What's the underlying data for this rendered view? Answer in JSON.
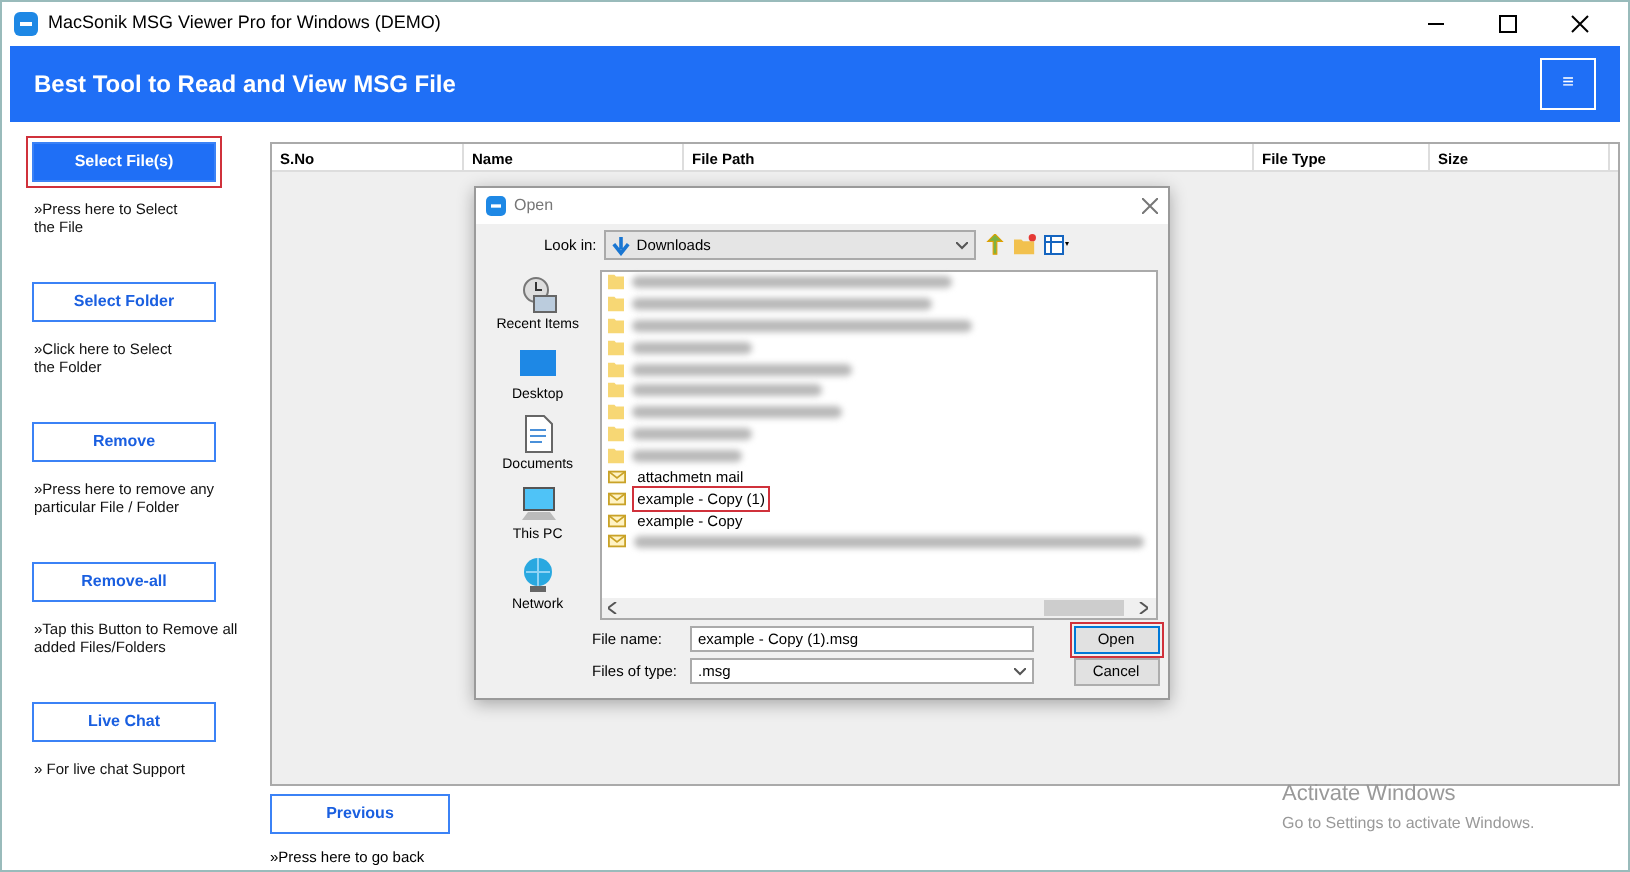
{
  "window": {
    "title": "MacSonik MSG Viewer Pro for Windows (DEMO)"
  },
  "header": {
    "title": "Best Tool to Read and View MSG File",
    "menu_button": "≡"
  },
  "actions": [
    {
      "label": "Select File(s)",
      "kind": "primary",
      "highlighted": true,
      "hint": "»Press here to Select\nthe File"
    },
    {
      "label": "Select Folder",
      "kind": "outline",
      "highlighted": false,
      "hint": "»Click here to Select\nthe Folder"
    },
    {
      "label": "Remove",
      "kind": "outline",
      "highlighted": false,
      "hint": "»Press here to remove any\nparticular File / Folder"
    },
    {
      "label": "Remove-all",
      "kind": "outline",
      "highlighted": false,
      "hint": "»Tap this Button to Remove all\nadded Files/Folders"
    },
    {
      "label": "Live Chat",
      "kind": "outline",
      "highlighted": false,
      "hint": "» For live chat Support"
    }
  ],
  "table": {
    "columns": [
      "S.No",
      "Name",
      "File Path",
      "File Type",
      "Size"
    ]
  },
  "previous": {
    "label": "Previous",
    "hint": "»Press here to go back"
  },
  "dialog": {
    "title": "Open",
    "look_in_label": "Look in:",
    "look_in": "Downloads",
    "places": [
      {
        "kind": "recent",
        "label": "Recent Items"
      },
      {
        "kind": "desktop",
        "label": "Desktop"
      },
      {
        "kind": "documents",
        "label": "Documents"
      },
      {
        "kind": "pc",
        "label": "This PC"
      },
      {
        "kind": "network",
        "label": "Network"
      }
    ],
    "files": [
      {
        "kind": "folder-blurred"
      },
      {
        "kind": "folder-blurred"
      },
      {
        "kind": "folder-blurred"
      },
      {
        "kind": "folder-blurred"
      },
      {
        "kind": "folder-blurred"
      },
      {
        "kind": "folder-blurred"
      },
      {
        "kind": "folder-blurred"
      },
      {
        "kind": "folder-blurred"
      },
      {
        "kind": "folder-blurred"
      },
      {
        "kind": "mail",
        "name": "attachmetn mail",
        "highlighted": false
      },
      {
        "kind": "mail",
        "name": "example - Copy (1)",
        "highlighted": true
      },
      {
        "kind": "mail",
        "name": "example - Copy",
        "highlighted": false
      },
      {
        "kind": "mail-blurred"
      }
    ],
    "file_name_label": "File name:",
    "file_name": "example - Copy (1).msg",
    "type_label": "Files of type:",
    "file_type": ".msg",
    "buttons": [
      {
        "label": "Open",
        "highlighted": true
      },
      {
        "label": "Cancel",
        "highlighted": false
      }
    ]
  },
  "watermark": {
    "title": "Activate Windows",
    "subtitle": "Go to Settings to activate Windows."
  }
}
